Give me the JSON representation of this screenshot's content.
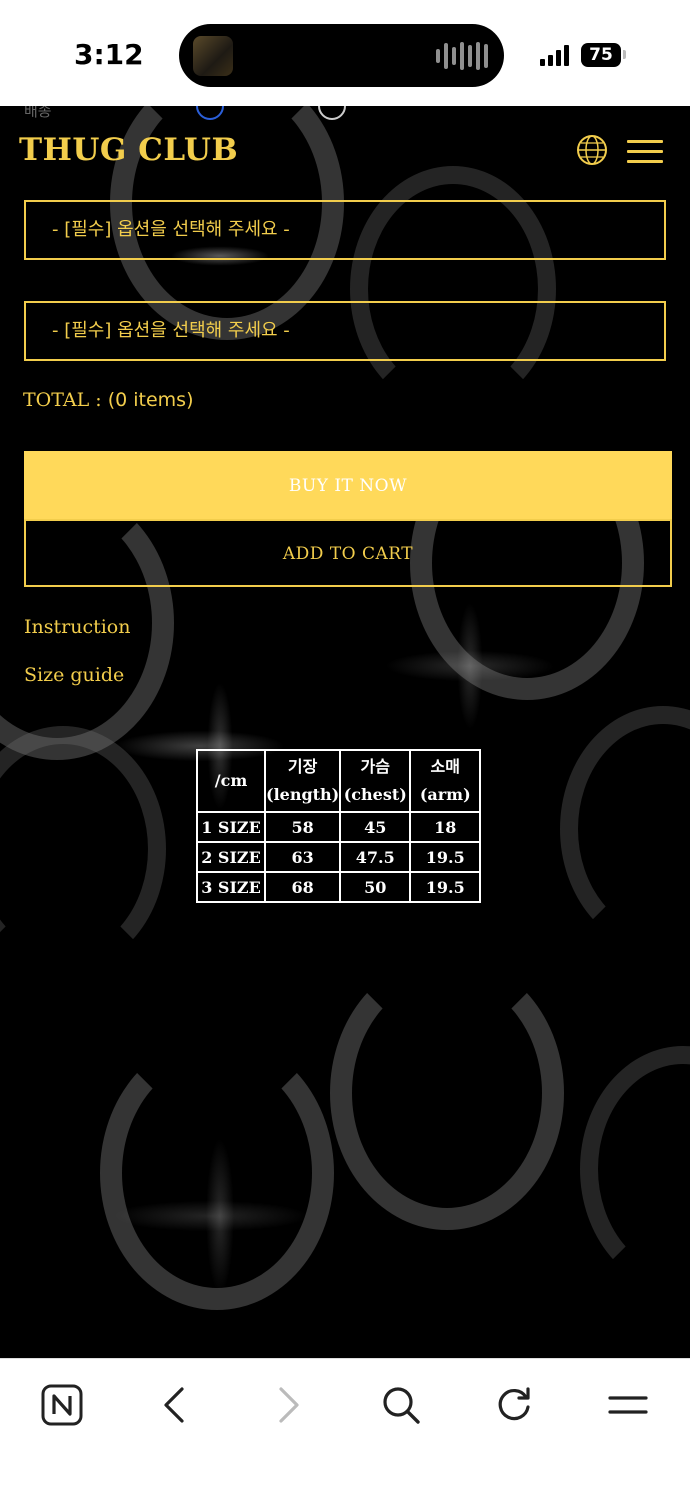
{
  "status_bar": {
    "time": "3:12",
    "battery": "75"
  },
  "page": {
    "top_hint": "배송",
    "brand": "THUG CLUB",
    "icons": {
      "globe": "globe-icon",
      "menu": "hamburger-menu-icon"
    },
    "option_selects": [
      {
        "placeholder": "- [필수] 옵션을 선택해 주세요 -"
      },
      {
        "placeholder": "- [필수] 옵션을 선택해 주세요 -"
      }
    ],
    "total": {
      "label": "TOTAL :",
      "value": "(0 items)"
    },
    "buttons": {
      "buy_now": "BUY IT NOW",
      "add_to_cart": "ADD TO CART"
    },
    "links": {
      "instruction": "Instruction",
      "size_guide": "Size guide"
    },
    "size_table": {
      "headers": [
        "/cm",
        "기장 (length)",
        "가슴 (chest)",
        "소매 (arm)"
      ],
      "rows": [
        [
          "1 SIZE",
          "58",
          "45",
          "18"
        ],
        [
          "2 SIZE",
          "63",
          "47.5",
          "19.5"
        ],
        [
          "3 SIZE",
          "68",
          "50",
          "19.5"
        ]
      ]
    },
    "colors": {
      "accent": "#f2cd4c",
      "buy_button": "#ffd95a",
      "background": "#000000"
    }
  },
  "toolbar": {
    "items": [
      "naver-icon",
      "back-icon",
      "forward-icon",
      "search-icon",
      "reload-icon",
      "menu-icon"
    ]
  }
}
